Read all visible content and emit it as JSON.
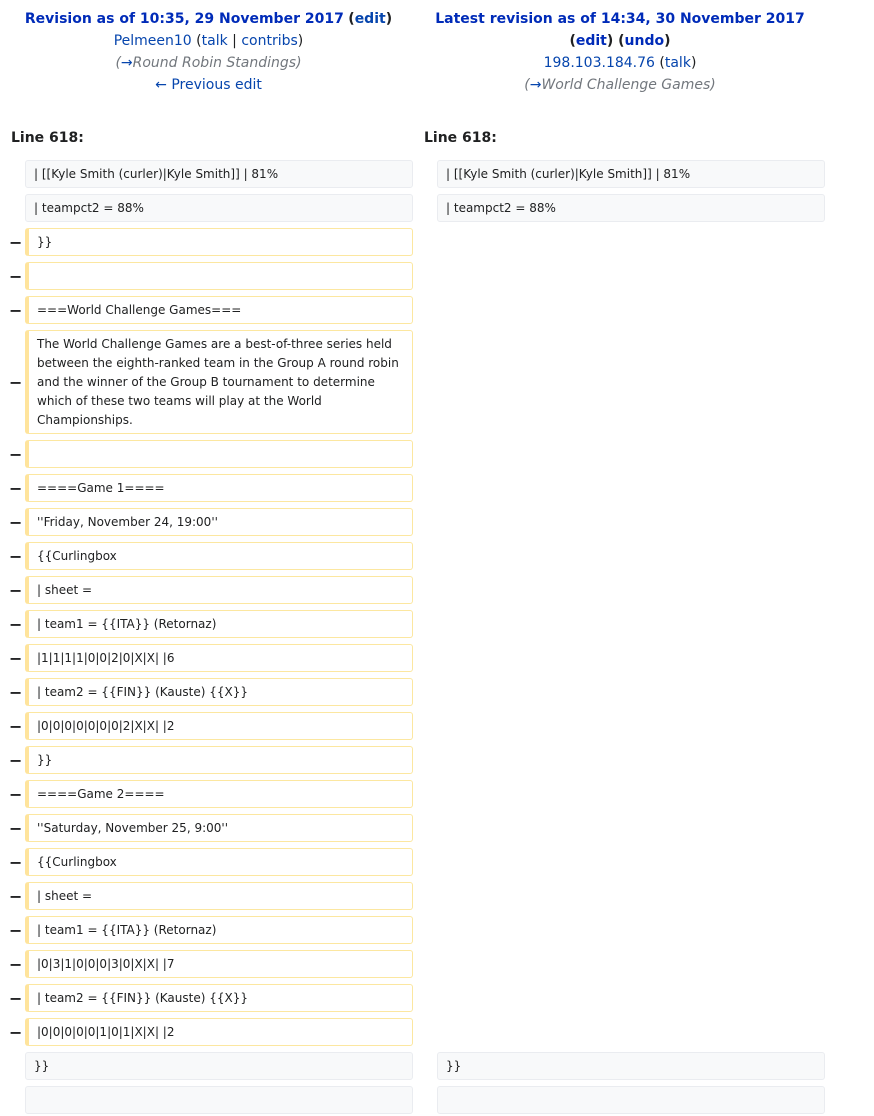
{
  "left_header": {
    "title": "Revision as of 10:35, 29 November 2017",
    "edit_label": "edit",
    "user": "Pelmeen10",
    "talk": "talk",
    "contribs": "contribs",
    "summary_arrow": "→",
    "summary": "Round Robin Standings",
    "previous_edit": "← Previous edit"
  },
  "right_header": {
    "title": "Latest revision as of 14:34, 30 November 2017",
    "edit_label": "edit",
    "undo_label": "undo",
    "user": "198.103.184.76",
    "talk": "talk",
    "summary_arrow": "→",
    "summary": "World Challenge Games"
  },
  "line_label_left": "Line 618:",
  "line_label_right": "Line 618:",
  "deletion_marker": "−",
  "diff_rows": [
    {
      "type": "context",
      "left": "| [[Kyle Smith (curler)|Kyle Smith]] | 81%",
      "right": "| [[Kyle Smith (curler)|Kyle Smith]] | 81%"
    },
    {
      "type": "context",
      "left": "| teampct2 = 88%",
      "right": "| teampct2 = 88%"
    },
    {
      "type": "deleted",
      "left": "}}"
    },
    {
      "type": "deleted",
      "left": ""
    },
    {
      "type": "deleted",
      "left": "===World Challenge Games==="
    },
    {
      "type": "deleted",
      "left": "The World Challenge Games are a best-of-three series held between the eighth-ranked team in the Group A round robin and the winner of the Group B tournament to determine which of these two teams will play at the World Championships."
    },
    {
      "type": "deleted",
      "left": ""
    },
    {
      "type": "deleted",
      "left": "====Game 1===="
    },
    {
      "type": "deleted",
      "left": "''Friday, November 24, 19:00''"
    },
    {
      "type": "deleted",
      "left": "{{Curlingbox"
    },
    {
      "type": "deleted",
      "left": "| sheet ="
    },
    {
      "type": "deleted",
      "left": "| team1 = {{ITA}} (Retornaz)"
    },
    {
      "type": "deleted",
      "left": "|1|1|1|1|0|0|2|0|X|X| |6"
    },
    {
      "type": "deleted",
      "left": "| team2 = {{FIN}} (Kauste) {{X}}"
    },
    {
      "type": "deleted",
      "left": "|0|0|0|0|0|0|0|2|X|X| |2"
    },
    {
      "type": "deleted",
      "left": "}}"
    },
    {
      "type": "deleted",
      "left": "====Game 2===="
    },
    {
      "type": "deleted",
      "left": "''Saturday, November 25, 9:00''"
    },
    {
      "type": "deleted",
      "left": "{{Curlingbox"
    },
    {
      "type": "deleted",
      "left": "| sheet ="
    },
    {
      "type": "deleted",
      "left": "| team1 = {{ITA}} (Retornaz)"
    },
    {
      "type": "deleted",
      "left": "|0|3|1|0|0|0|3|0|X|X| |7"
    },
    {
      "type": "deleted",
      "left": "| team2 = {{FIN}} (Kauste) {{X}}"
    },
    {
      "type": "deleted",
      "left": "|0|0|0|0|0|1|0|1|X|X| |2"
    },
    {
      "type": "context",
      "left": "}}",
      "right": "}}"
    },
    {
      "type": "context",
      "left": "",
      "right": ""
    }
  ]
}
